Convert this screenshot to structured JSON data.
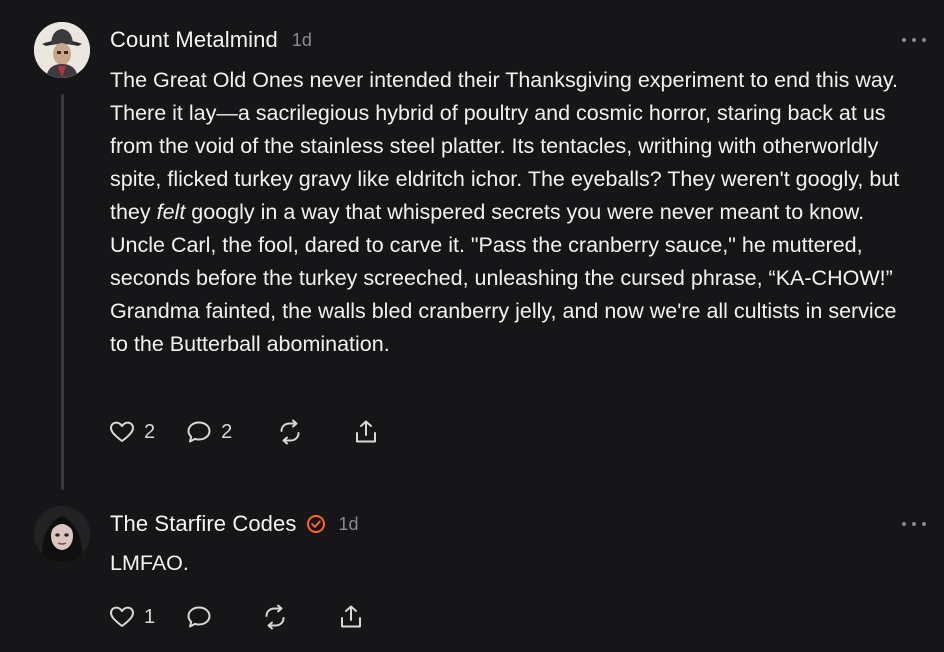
{
  "comments": [
    {
      "author": "Count Metalmind",
      "time": "1d",
      "text_before": "The Great Old Ones never intended their Thanksgiving experiment to end this way. There it lay—a sacrilegious hybrid of poultry and cosmic horror, staring back at us from the void of the stainless steel platter. Its tentacles, writhing with otherworldly spite, flicked turkey gravy like eldritch ichor. The eyeballs? They weren't googly, but they ",
      "text_em": "felt",
      "text_after": " googly in a way that whispered secrets you were never meant to know. Uncle Carl, the fool, dared to carve it. \"Pass the cranberry sauce,\" he muttered, seconds before the turkey screeched, unleashing the cursed phrase, “KA-CHOW!” Grandma fainted, the walls bled cranberry jelly, and now we're all cultists in service to the Butterball abomination.",
      "likes": "2",
      "replies": "2"
    },
    {
      "author": "The Starfire Codes",
      "time": "1d",
      "verified": true,
      "text": "LMFAO.",
      "likes": "1"
    }
  ],
  "icons": [
    "heart-icon",
    "comment-icon",
    "restack-icon",
    "share-icon",
    "more-icon",
    "verified-icon"
  ],
  "colors": {
    "background": "#161618",
    "text": "#f2f2f2",
    "muted": "#8a8a8e",
    "accent": "#ff6719",
    "thread_line": "#3a3a3c"
  }
}
